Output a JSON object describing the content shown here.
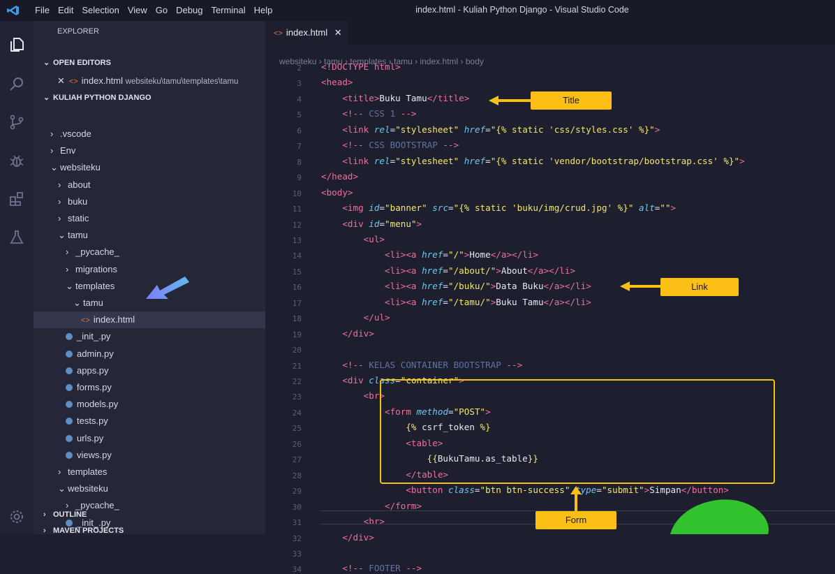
{
  "titlebar": {
    "menu": [
      "File",
      "Edit",
      "Selection",
      "View",
      "Go",
      "Debug",
      "Terminal",
      "Help"
    ],
    "window_title": "index.html - Kuliah Python Django - Visual Studio Code"
  },
  "activity_icons": [
    "files-icon",
    "search-icon",
    "source-control-icon",
    "debug-icon",
    "extensions-icon",
    "test-flask-icon",
    "settings-gear-icon"
  ],
  "sidebar": {
    "header": "EXPLORER",
    "open_editors_label": "OPEN EDITORS",
    "open_editor": {
      "name": "index.html",
      "path": "websiteku\\tamu\\templates\\tamu"
    },
    "project_label": "KULIAH PYTHON DJANGO",
    "tree": [
      {
        "label": ".vscode",
        "kind": "folder",
        "open": false,
        "depth": 0
      },
      {
        "label": "Env",
        "kind": "folder",
        "open": false,
        "depth": 0
      },
      {
        "label": "websiteku",
        "kind": "folder",
        "open": true,
        "depth": 0
      },
      {
        "label": "about",
        "kind": "folder",
        "open": false,
        "depth": 1
      },
      {
        "label": "buku",
        "kind": "folder",
        "open": false,
        "depth": 1
      },
      {
        "label": "static",
        "kind": "folder",
        "open": false,
        "depth": 1
      },
      {
        "label": "tamu",
        "kind": "folder",
        "open": true,
        "depth": 1
      },
      {
        "label": "_pycache_",
        "kind": "folder",
        "open": false,
        "depth": 2
      },
      {
        "label": "migrations",
        "kind": "folder",
        "open": false,
        "depth": 2
      },
      {
        "label": "templates",
        "kind": "folder",
        "open": true,
        "depth": 2
      },
      {
        "label": "tamu",
        "kind": "folder",
        "open": true,
        "depth": 3
      },
      {
        "label": "index.html",
        "kind": "html",
        "depth": 4,
        "selected": true
      },
      {
        "label": "_init_.py",
        "kind": "py",
        "depth": 2
      },
      {
        "label": "admin.py",
        "kind": "py",
        "depth": 2
      },
      {
        "label": "apps.py",
        "kind": "py",
        "depth": 2
      },
      {
        "label": "forms.py",
        "kind": "py",
        "depth": 2
      },
      {
        "label": "models.py",
        "kind": "py",
        "depth": 2
      },
      {
        "label": "tests.py",
        "kind": "py",
        "depth": 2
      },
      {
        "label": "urls.py",
        "kind": "py",
        "depth": 2
      },
      {
        "label": "views.py",
        "kind": "py",
        "depth": 2
      },
      {
        "label": "templates",
        "kind": "folder",
        "open": false,
        "depth": 1
      },
      {
        "label": "websiteku",
        "kind": "folder",
        "open": true,
        "depth": 1
      },
      {
        "label": "_pycache_",
        "kind": "folder",
        "open": false,
        "depth": 2
      },
      {
        "label": "_init_.py",
        "kind": "py",
        "depth": 2
      }
    ],
    "outline_label": "OUTLINE",
    "maven_label": "MAVEN PROJECTS"
  },
  "editor": {
    "tab_label": "index.html",
    "breadcrumb": [
      "websiteku",
      "tamu",
      "templates",
      "tamu",
      "index.html",
      "body"
    ],
    "lines": [
      {
        "n": "2",
        "tokens": [
          [
            "tg",
            "<!DOCTYPE html>"
          ]
        ]
      },
      {
        "n": "3",
        "tokens": [
          [
            "tg",
            "<head>"
          ]
        ]
      },
      {
        "n": "4",
        "tokens": [
          [
            "pl",
            "    "
          ],
          [
            "tg",
            "<title>"
          ],
          [
            "pl",
            "Buku Tamu"
          ],
          [
            "tg",
            "</title>"
          ]
        ]
      },
      {
        "n": "5",
        "tokens": [
          [
            "pl",
            "    "
          ],
          [
            "tg",
            "<!-- "
          ],
          [
            "cm",
            "CSS 1 "
          ],
          [
            "tg",
            "-->"
          ]
        ]
      },
      {
        "n": "6",
        "tokens": [
          [
            "pl",
            "    "
          ],
          [
            "tg",
            "<link "
          ],
          [
            "at",
            "rel"
          ],
          [
            "pl",
            "="
          ],
          [
            "st",
            "\"stylesheet\""
          ],
          [
            "pl",
            " "
          ],
          [
            "at",
            "href"
          ],
          [
            "pl",
            "="
          ],
          [
            "st",
            "\"{% static 'css/styles.css' %}\""
          ],
          [
            "tg",
            ">"
          ]
        ]
      },
      {
        "n": "7",
        "tokens": [
          [
            "pl",
            "    "
          ],
          [
            "tg",
            "<!-- "
          ],
          [
            "cm",
            "CSS BOOTSTRAP "
          ],
          [
            "tg",
            "-->"
          ]
        ]
      },
      {
        "n": "8",
        "tokens": [
          [
            "pl",
            "    "
          ],
          [
            "tg",
            "<link "
          ],
          [
            "at",
            "rel"
          ],
          [
            "pl",
            "="
          ],
          [
            "st",
            "\"stylesheet\""
          ],
          [
            "pl",
            " "
          ],
          [
            "at",
            "href"
          ],
          [
            "pl",
            "="
          ],
          [
            "st",
            "\"{% static 'vendor/bootstrap/bootstrap.css' %}\""
          ],
          [
            "tg",
            ">"
          ]
        ]
      },
      {
        "n": "9",
        "tokens": [
          [
            "tg",
            "</head>"
          ]
        ]
      },
      {
        "n": "10",
        "tokens": [
          [
            "tg",
            "<body>"
          ]
        ]
      },
      {
        "n": "11",
        "tokens": [
          [
            "pl",
            "    "
          ],
          [
            "tg",
            "<img "
          ],
          [
            "at",
            "id"
          ],
          [
            "pl",
            "="
          ],
          [
            "st",
            "\"banner\""
          ],
          [
            "pl",
            " "
          ],
          [
            "at",
            "src"
          ],
          [
            "pl",
            "="
          ],
          [
            "st",
            "\"{% static 'buku/img/crud.jpg' %}\""
          ],
          [
            "pl",
            " "
          ],
          [
            "at",
            "alt"
          ],
          [
            "pl",
            "="
          ],
          [
            "st",
            "\"\""
          ],
          [
            "tg",
            ">"
          ]
        ]
      },
      {
        "n": "12",
        "tokens": [
          [
            "pl",
            "    "
          ],
          [
            "tg",
            "<div "
          ],
          [
            "at",
            "id"
          ],
          [
            "pl",
            "="
          ],
          [
            "st",
            "\"menu\""
          ],
          [
            "tg",
            ">"
          ]
        ]
      },
      {
        "n": "13",
        "tokens": [
          [
            "pl",
            "        "
          ],
          [
            "tg",
            "<ul>"
          ]
        ]
      },
      {
        "n": "14",
        "tokens": [
          [
            "pl",
            "            "
          ],
          [
            "tg",
            "<li><a "
          ],
          [
            "at",
            "href"
          ],
          [
            "pl",
            "="
          ],
          [
            "st",
            "\"/\""
          ],
          [
            "tg",
            ">"
          ],
          [
            "pl",
            "Home"
          ],
          [
            "tg",
            "</a></li>"
          ]
        ]
      },
      {
        "n": "15",
        "tokens": [
          [
            "pl",
            "            "
          ],
          [
            "tg",
            "<li><a "
          ],
          [
            "at",
            "href"
          ],
          [
            "pl",
            "="
          ],
          [
            "st",
            "\"/about/\""
          ],
          [
            "tg",
            ">"
          ],
          [
            "pl",
            "About"
          ],
          [
            "tg",
            "</a></li>"
          ]
        ]
      },
      {
        "n": "16",
        "tokens": [
          [
            "pl",
            "            "
          ],
          [
            "tg",
            "<li><a "
          ],
          [
            "at",
            "href"
          ],
          [
            "pl",
            "="
          ],
          [
            "st",
            "\"/buku/\""
          ],
          [
            "tg",
            ">"
          ],
          [
            "pl",
            "Data Buku"
          ],
          [
            "tg",
            "</a></li>"
          ]
        ]
      },
      {
        "n": "17",
        "tokens": [
          [
            "pl",
            "            "
          ],
          [
            "tg",
            "<li><a "
          ],
          [
            "at",
            "href"
          ],
          [
            "pl",
            "="
          ],
          [
            "st",
            "\"/tamu/\""
          ],
          [
            "tg",
            ">"
          ],
          [
            "pl",
            "Buku Tamu"
          ],
          [
            "tg",
            "</a></li>"
          ]
        ]
      },
      {
        "n": "18",
        "tokens": [
          [
            "pl",
            "        "
          ],
          [
            "tg",
            "</ul>"
          ]
        ]
      },
      {
        "n": "19",
        "tokens": [
          [
            "pl",
            "    "
          ],
          [
            "tg",
            "</div>"
          ]
        ]
      },
      {
        "n": "20",
        "tokens": []
      },
      {
        "n": "21",
        "tokens": [
          [
            "pl",
            "    "
          ],
          [
            "tg",
            "<!-- "
          ],
          [
            "cm",
            "KELAS CONTAINER BOOTSTRAP "
          ],
          [
            "tg",
            "-->"
          ]
        ]
      },
      {
        "n": "22",
        "tokens": [
          [
            "pl",
            "    "
          ],
          [
            "tg",
            "<div "
          ],
          [
            "at",
            "class"
          ],
          [
            "pl",
            "="
          ],
          [
            "st",
            "\"container\""
          ],
          [
            "tg",
            ">"
          ]
        ]
      },
      {
        "n": "23",
        "tokens": [
          [
            "pl",
            "        "
          ],
          [
            "tg",
            "<br>"
          ]
        ]
      },
      {
        "n": "24",
        "tokens": [
          [
            "pl",
            "            "
          ],
          [
            "tg",
            "<form "
          ],
          [
            "at",
            "method"
          ],
          [
            "pl",
            "="
          ],
          [
            "st",
            "\"POST\""
          ],
          [
            "tg",
            ">"
          ]
        ]
      },
      {
        "n": "25",
        "tokens": [
          [
            "pl",
            "                "
          ],
          [
            "st",
            "{%"
          ],
          [
            "pl",
            " csrf_token "
          ],
          [
            "st",
            "%}"
          ]
        ]
      },
      {
        "n": "26",
        "tokens": [
          [
            "pl",
            "                "
          ],
          [
            "tg",
            "<table>"
          ]
        ]
      },
      {
        "n": "27",
        "tokens": [
          [
            "pl",
            "                    "
          ],
          [
            "st",
            "{{"
          ],
          [
            "pl",
            "BukuTamu.as_table"
          ],
          [
            "st",
            "}}"
          ]
        ]
      },
      {
        "n": "28",
        "tokens": [
          [
            "pl",
            "                "
          ],
          [
            "tg",
            "</table>"
          ]
        ]
      },
      {
        "n": "29",
        "tokens": [
          [
            "pl",
            "                "
          ],
          [
            "tg",
            "<button "
          ],
          [
            "at",
            "class"
          ],
          [
            "pl",
            "="
          ],
          [
            "st",
            "\"btn btn-success\""
          ],
          [
            "pl",
            " "
          ],
          [
            "at",
            "type"
          ],
          [
            "pl",
            "="
          ],
          [
            "st",
            "\"submit\""
          ],
          [
            "tg",
            ">"
          ],
          [
            "pl",
            "Simpan"
          ],
          [
            "tg",
            "</button>"
          ]
        ]
      },
      {
        "n": "30",
        "tokens": [
          [
            "pl",
            "            "
          ],
          [
            "tg",
            "</form>"
          ]
        ]
      },
      {
        "n": "31",
        "tokens": [
          [
            "pl",
            "        "
          ],
          [
            "tg",
            "<br>"
          ]
        ]
      },
      {
        "n": "32",
        "tokens": [
          [
            "pl",
            "    "
          ],
          [
            "tg",
            "</div>"
          ]
        ]
      },
      {
        "n": "33",
        "tokens": []
      },
      {
        "n": "34",
        "tokens": [
          [
            "pl",
            "    "
          ],
          [
            "tg",
            "<!-- "
          ],
          [
            "cm",
            "FOOTER "
          ],
          [
            "tg",
            "-->"
          ]
        ]
      }
    ]
  },
  "annotations": {
    "title": "Title",
    "link": "Link",
    "form": "Form"
  },
  "colors": {
    "annotation": "#fbbf16",
    "tag": "#ef6f9e",
    "attr": "#6cc7f0",
    "string": "#f5e66d",
    "comment": "#6272a4"
  }
}
